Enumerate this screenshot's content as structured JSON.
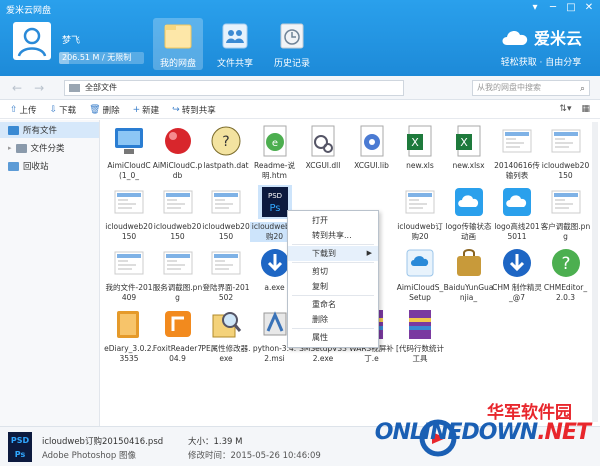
{
  "window": {
    "title": "爱米云网盘",
    "controls": [
      "minimize",
      "restore",
      "maximize",
      "close"
    ]
  },
  "user": {
    "name": "梦飞",
    "quota_text": "206.51 M / 无限制",
    "quota_fraction": 0.12
  },
  "nav": {
    "tabs": [
      {
        "label": "我的网盘",
        "active": true,
        "icon": "folder-icon"
      },
      {
        "label": "文件共享",
        "active": false,
        "icon": "users-icon"
      },
      {
        "label": "历史记录",
        "active": false,
        "icon": "clock-icon"
      }
    ]
  },
  "brand": {
    "name": "爱米云",
    "slogan": "轻松获取 · 自由分享"
  },
  "address": {
    "path": "全部文件",
    "search_placeholder": "从我的网盘中搜索"
  },
  "toolbar": {
    "upload": "上传",
    "download": "下载",
    "delete": "删除",
    "new": "新建",
    "share": "转到共享"
  },
  "sidebar": {
    "items": [
      "所有文件",
      "文件分类",
      "回收站"
    ]
  },
  "files": [
    {
      "name": "AimiCloudC(1_0_",
      "kind": "exe-pc"
    },
    {
      "name": "AiMiCloudC.pdb",
      "kind": "red-ball"
    },
    {
      "name": "lastpath.dat",
      "kind": "dat"
    },
    {
      "name": "Readme-说明.htm",
      "kind": "htm"
    },
    {
      "name": "XCGUI.dll",
      "kind": "dll"
    },
    {
      "name": "XCGUI.lib",
      "kind": "lib"
    },
    {
      "name": "new.xls",
      "kind": "xls"
    },
    {
      "name": "new.xlsx",
      "kind": "xls"
    },
    {
      "name": "20140616传输列表",
      "kind": "png"
    },
    {
      "name": "icloudweb20150",
      "kind": "png"
    },
    {
      "name": "icloudweb20150",
      "kind": "png"
    },
    {
      "name": "icloudweb20150",
      "kind": "png"
    },
    {
      "name": "icloudweb20150",
      "kind": "png"
    },
    {
      "name": "icloudweb订购20",
      "kind": "psd"
    },
    {
      "name": "",
      "kind": "hidden"
    },
    {
      "name": "",
      "kind": "hidden"
    },
    {
      "name": "icloudweb订购20",
      "kind": "png"
    },
    {
      "name": "logo传输状态动画",
      "kind": "logo"
    },
    {
      "name": "logo高线2015011",
      "kind": "logo"
    },
    {
      "name": "客户调截图.png",
      "kind": "png"
    },
    {
      "name": "我的文件-201409",
      "kind": "png"
    },
    {
      "name": "服务调截图.png",
      "kind": "png"
    },
    {
      "name": "登陆界面-201502",
      "kind": "png"
    },
    {
      "name": "a.exe",
      "kind": "blue-down"
    },
    {
      "name": "",
      "kind": "hidden"
    },
    {
      "name": "",
      "kind": "hidden"
    },
    {
      "name": "AimiCloudS_Setup",
      "kind": "setup"
    },
    {
      "name": "BaiduYunGuanjia_",
      "kind": "bag"
    },
    {
      "name": "CHM 制作精灵_@7",
      "kind": "blue-down"
    },
    {
      "name": "CHMEditor_2.0.3",
      "kind": "help"
    },
    {
      "name": "eDiary_3.0.2.3535",
      "kind": "book"
    },
    {
      "name": "FoxitReader704.9",
      "kind": "foxit"
    },
    {
      "name": "PE属性修改器.exe",
      "kind": "magnifier"
    },
    {
      "name": "python-3.4.2.msi",
      "kind": "msi"
    },
    {
      "name": "SMSetupV332.exe",
      "kind": "setup"
    },
    {
      "name": "WAR3视屏补丁.e",
      "kind": "rar"
    },
    {
      "name": "[代码行数统计工具",
      "kind": "rar"
    }
  ],
  "context_menu": {
    "items": [
      "打开",
      "转到共享...",
      "下载到",
      "剪切",
      "复制",
      "重命名",
      "删除",
      "属性"
    ]
  },
  "status": {
    "name": "icloudweb订购20150416.psd",
    "type": "Adobe Photoshop 图像",
    "size": "大小：1.39 M",
    "date": "修改时间：2015-05-26 10:46:09"
  },
  "watermark": {
    "cn": "华军软件园",
    "en_a": "ONLINEDOWN",
    "en_b": ".NET"
  }
}
